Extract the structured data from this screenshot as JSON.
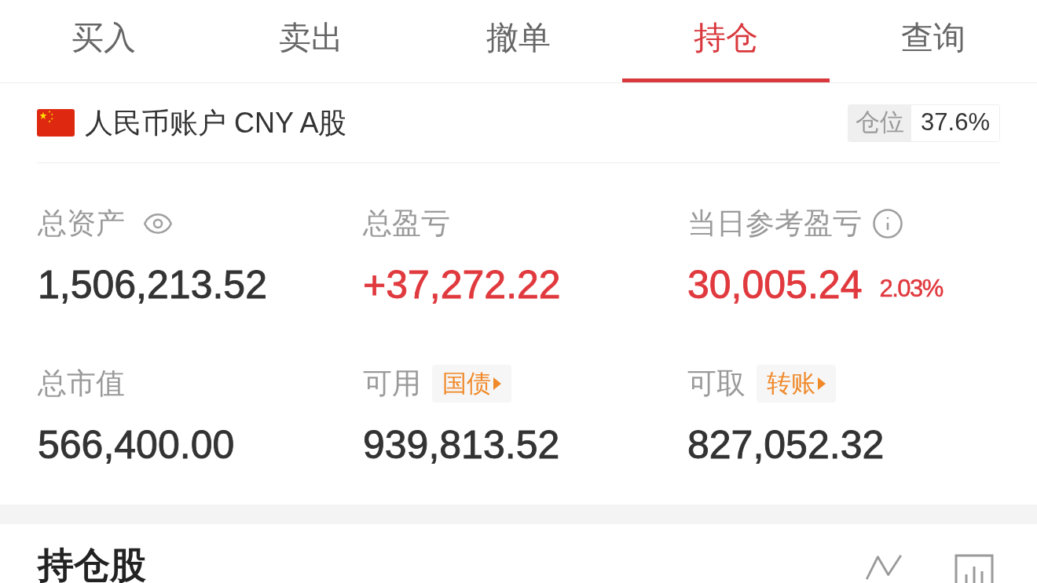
{
  "tabs": [
    {
      "label": "买入",
      "selected": false
    },
    {
      "label": "卖出",
      "selected": false
    },
    {
      "label": "撤单",
      "selected": false
    },
    {
      "label": "持仓",
      "selected": true
    },
    {
      "label": "查询",
      "selected": false
    }
  ],
  "account": {
    "name": "人民币账户 CNY A股",
    "position": {
      "label": "仓位",
      "value": "37.6%"
    }
  },
  "stats": [
    {
      "label": "总资产",
      "kind": "privacy",
      "value": "1,506,213.52",
      "color": "#333333"
    },
    {
      "label": "总盈亏",
      "kind": "plain",
      "value": "+37,272.22",
      "color": "#e0393e"
    },
    {
      "label": "当日参考盈亏",
      "kind": "hint",
      "value": "30,005.24",
      "change": "2.03%",
      "color": "#e0393e"
    },
    {
      "label": "总市值",
      "kind": "plain",
      "value": "566,400.00",
      "color": "#333333"
    },
    {
      "label": "可用",
      "kind": "action",
      "action": "国债",
      "value": "939,813.52",
      "color": "#333333"
    },
    {
      "label": "可取",
      "kind": "action",
      "action": "转账",
      "value": "827,052.32",
      "color": "#333333"
    }
  ],
  "holdings": {
    "title": "持仓股"
  }
}
